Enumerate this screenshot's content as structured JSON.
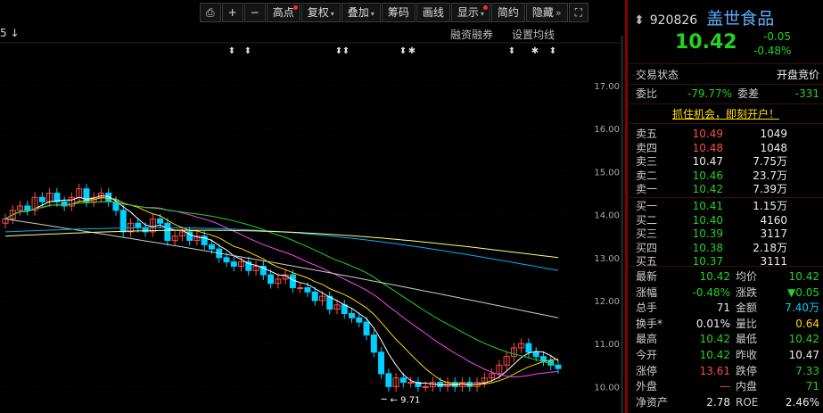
{
  "toolbar": {
    "buttons": [
      {
        "label": "",
        "icon": "lock-icon"
      },
      {
        "label": "+",
        "icon": "zoom-in"
      },
      {
        "label": "−",
        "icon": "zoom-out"
      },
      {
        "label": "高点",
        "dot": true
      },
      {
        "label": "复权",
        "dot": false,
        "caret": true
      },
      {
        "label": "叠加",
        "caret": true
      },
      {
        "label": "筹码"
      },
      {
        "label": "画线"
      },
      {
        "label": "显示",
        "caret": true,
        "dot": true
      },
      {
        "label": "简约"
      },
      {
        "label": "隐藏"
      },
      {
        "label": "",
        "icon": "fullscreen-icon"
      }
    ]
  },
  "chart": {
    "left_marker": "5 ↓",
    "sub_left": "融资融券",
    "sub_right": "设置均线",
    "min_price_label": "9.71",
    "y_ticks": [
      "17.00",
      "16.00",
      "15.00",
      "14.00",
      "13.00",
      "12.00",
      "11.00",
      "10.00"
    ],
    "up_color": "#ff4a4a",
    "down_color": "#00d0ff",
    "ma_colors": {
      "ma5": "#ffffff",
      "ma10": "#ffd800",
      "ma20": "#ff44ff",
      "ma30": "#22d322",
      "ma60": "#cccccc",
      "ma120": "#00b0ff",
      "ma250": "#ffff80"
    }
  },
  "stock": {
    "code": "920826",
    "name": "盖世食品",
    "price": "10.42",
    "change": "-0.05",
    "change_pct": "-0.48%"
  },
  "status": {
    "label": "交易状态",
    "value": "开盘竞价"
  },
  "ratio": {
    "wb_label": "委比",
    "wb_value": "-79.77%",
    "wc_label": "委差",
    "wc_value": "-331"
  },
  "promo": "抓住机会，即刻开户！",
  "sells": [
    {
      "label": "卖五",
      "price": "10.49",
      "vol": "1049",
      "color": "red"
    },
    {
      "label": "卖四",
      "price": "10.48",
      "vol": "1048",
      "color": "red"
    },
    {
      "label": "卖三",
      "price": "10.47",
      "vol": "7.75万",
      "color": "white"
    },
    {
      "label": "卖二",
      "price": "10.46",
      "vol": "23.7万",
      "color": "green"
    },
    {
      "label": "卖一",
      "price": "10.42",
      "vol": "7.39万",
      "color": "green"
    }
  ],
  "buys": [
    {
      "label": "买一",
      "price": "10.41",
      "vol": "1.15万",
      "color": "green"
    },
    {
      "label": "买二",
      "price": "10.40",
      "vol": "4160",
      "color": "green"
    },
    {
      "label": "买三",
      "price": "10.39",
      "vol": "3117",
      "color": "green"
    },
    {
      "label": "买四",
      "price": "10.38",
      "vol": "2.18万",
      "color": "green"
    },
    {
      "label": "买五",
      "price": "10.37",
      "vol": "3111",
      "color": "green"
    }
  ],
  "stats": [
    {
      "l1": "最新",
      "v1": "10.42",
      "c1": "green",
      "l2": "均价",
      "v2": "10.42",
      "c2": "green"
    },
    {
      "l1": "涨幅",
      "v1": "-0.48%",
      "c1": "green",
      "l2": "涨跌",
      "v2": "▼0.05",
      "c2": "green"
    },
    {
      "l1": "总手",
      "v1": "71",
      "c1": "white",
      "l2": "金额",
      "v2": "7.40万",
      "c2": "cyan"
    },
    {
      "l1": "换手*",
      "v1": "0.01%",
      "c1": "white",
      "l2": "量比",
      "v2": "0.64",
      "c2": "yellow"
    },
    {
      "l1": "最高",
      "v1": "10.42",
      "c1": "green",
      "l2": "最低",
      "v2": "10.42",
      "c2": "green"
    },
    {
      "l1": "今开",
      "v1": "10.42",
      "c1": "green",
      "l2": "昨收",
      "v2": "10.47",
      "c2": "white"
    },
    {
      "l1": "涨停",
      "v1": "13.61",
      "c1": "red",
      "l2": "跌停",
      "v2": "7.33",
      "c2": "green"
    },
    {
      "l1": "外盘",
      "v1": "—",
      "c1": "red",
      "l2": "内盘",
      "v2": "71",
      "c2": "green"
    },
    {
      "l1": "净资产",
      "v1": "2.78",
      "c1": "white",
      "l2": "ROE",
      "v2": "2.46%",
      "c2": "white"
    }
  ]
}
